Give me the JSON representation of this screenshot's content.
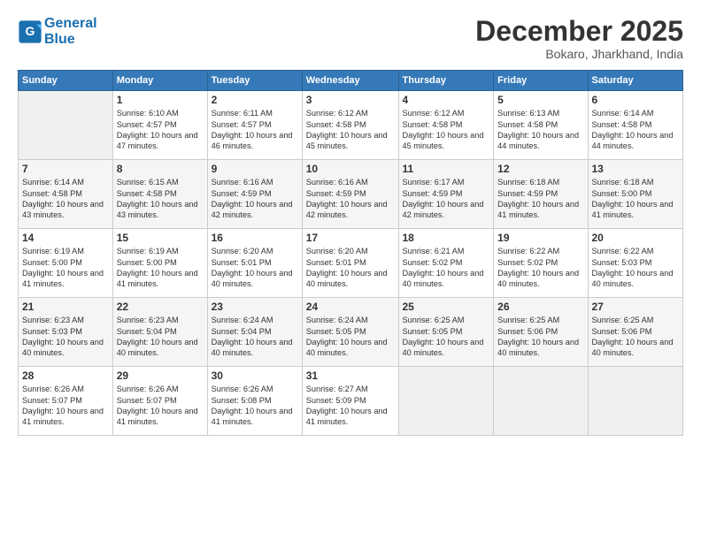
{
  "header": {
    "logo_line1": "General",
    "logo_line2": "Blue",
    "month": "December 2025",
    "location": "Bokaro, Jharkhand, India"
  },
  "days_of_week": [
    "Sunday",
    "Monday",
    "Tuesday",
    "Wednesday",
    "Thursday",
    "Friday",
    "Saturday"
  ],
  "weeks": [
    [
      {
        "day": "",
        "sunrise": "",
        "sunset": "",
        "daylight": ""
      },
      {
        "day": "1",
        "sunrise": "Sunrise: 6:10 AM",
        "sunset": "Sunset: 4:57 PM",
        "daylight": "Daylight: 10 hours and 47 minutes."
      },
      {
        "day": "2",
        "sunrise": "Sunrise: 6:11 AM",
        "sunset": "Sunset: 4:57 PM",
        "daylight": "Daylight: 10 hours and 46 minutes."
      },
      {
        "day": "3",
        "sunrise": "Sunrise: 6:12 AM",
        "sunset": "Sunset: 4:58 PM",
        "daylight": "Daylight: 10 hours and 45 minutes."
      },
      {
        "day": "4",
        "sunrise": "Sunrise: 6:12 AM",
        "sunset": "Sunset: 4:58 PM",
        "daylight": "Daylight: 10 hours and 45 minutes."
      },
      {
        "day": "5",
        "sunrise": "Sunrise: 6:13 AM",
        "sunset": "Sunset: 4:58 PM",
        "daylight": "Daylight: 10 hours and 44 minutes."
      },
      {
        "day": "6",
        "sunrise": "Sunrise: 6:14 AM",
        "sunset": "Sunset: 4:58 PM",
        "daylight": "Daylight: 10 hours and 44 minutes."
      }
    ],
    [
      {
        "day": "7",
        "sunrise": "Sunrise: 6:14 AM",
        "sunset": "Sunset: 4:58 PM",
        "daylight": "Daylight: 10 hours and 43 minutes."
      },
      {
        "day": "8",
        "sunrise": "Sunrise: 6:15 AM",
        "sunset": "Sunset: 4:58 PM",
        "daylight": "Daylight: 10 hours and 43 minutes."
      },
      {
        "day": "9",
        "sunrise": "Sunrise: 6:16 AM",
        "sunset": "Sunset: 4:59 PM",
        "daylight": "Daylight: 10 hours and 42 minutes."
      },
      {
        "day": "10",
        "sunrise": "Sunrise: 6:16 AM",
        "sunset": "Sunset: 4:59 PM",
        "daylight": "Daylight: 10 hours and 42 minutes."
      },
      {
        "day": "11",
        "sunrise": "Sunrise: 6:17 AM",
        "sunset": "Sunset: 4:59 PM",
        "daylight": "Daylight: 10 hours and 42 minutes."
      },
      {
        "day": "12",
        "sunrise": "Sunrise: 6:18 AM",
        "sunset": "Sunset: 4:59 PM",
        "daylight": "Daylight: 10 hours and 41 minutes."
      },
      {
        "day": "13",
        "sunrise": "Sunrise: 6:18 AM",
        "sunset": "Sunset: 5:00 PM",
        "daylight": "Daylight: 10 hours and 41 minutes."
      }
    ],
    [
      {
        "day": "14",
        "sunrise": "Sunrise: 6:19 AM",
        "sunset": "Sunset: 5:00 PM",
        "daylight": "Daylight: 10 hours and 41 minutes."
      },
      {
        "day": "15",
        "sunrise": "Sunrise: 6:19 AM",
        "sunset": "Sunset: 5:00 PM",
        "daylight": "Daylight: 10 hours and 41 minutes."
      },
      {
        "day": "16",
        "sunrise": "Sunrise: 6:20 AM",
        "sunset": "Sunset: 5:01 PM",
        "daylight": "Daylight: 10 hours and 40 minutes."
      },
      {
        "day": "17",
        "sunrise": "Sunrise: 6:20 AM",
        "sunset": "Sunset: 5:01 PM",
        "daylight": "Daylight: 10 hours and 40 minutes."
      },
      {
        "day": "18",
        "sunrise": "Sunrise: 6:21 AM",
        "sunset": "Sunset: 5:02 PM",
        "daylight": "Daylight: 10 hours and 40 minutes."
      },
      {
        "day": "19",
        "sunrise": "Sunrise: 6:22 AM",
        "sunset": "Sunset: 5:02 PM",
        "daylight": "Daylight: 10 hours and 40 minutes."
      },
      {
        "day": "20",
        "sunrise": "Sunrise: 6:22 AM",
        "sunset": "Sunset: 5:03 PM",
        "daylight": "Daylight: 10 hours and 40 minutes."
      }
    ],
    [
      {
        "day": "21",
        "sunrise": "Sunrise: 6:23 AM",
        "sunset": "Sunset: 5:03 PM",
        "daylight": "Daylight: 10 hours and 40 minutes."
      },
      {
        "day": "22",
        "sunrise": "Sunrise: 6:23 AM",
        "sunset": "Sunset: 5:04 PM",
        "daylight": "Daylight: 10 hours and 40 minutes."
      },
      {
        "day": "23",
        "sunrise": "Sunrise: 6:24 AM",
        "sunset": "Sunset: 5:04 PM",
        "daylight": "Daylight: 10 hours and 40 minutes."
      },
      {
        "day": "24",
        "sunrise": "Sunrise: 6:24 AM",
        "sunset": "Sunset: 5:05 PM",
        "daylight": "Daylight: 10 hours and 40 minutes."
      },
      {
        "day": "25",
        "sunrise": "Sunrise: 6:25 AM",
        "sunset": "Sunset: 5:05 PM",
        "daylight": "Daylight: 10 hours and 40 minutes."
      },
      {
        "day": "26",
        "sunrise": "Sunrise: 6:25 AM",
        "sunset": "Sunset: 5:06 PM",
        "daylight": "Daylight: 10 hours and 40 minutes."
      },
      {
        "day": "27",
        "sunrise": "Sunrise: 6:25 AM",
        "sunset": "Sunset: 5:06 PM",
        "daylight": "Daylight: 10 hours and 40 minutes."
      }
    ],
    [
      {
        "day": "28",
        "sunrise": "Sunrise: 6:26 AM",
        "sunset": "Sunset: 5:07 PM",
        "daylight": "Daylight: 10 hours and 41 minutes."
      },
      {
        "day": "29",
        "sunrise": "Sunrise: 6:26 AM",
        "sunset": "Sunset: 5:07 PM",
        "daylight": "Daylight: 10 hours and 41 minutes."
      },
      {
        "day": "30",
        "sunrise": "Sunrise: 6:26 AM",
        "sunset": "Sunset: 5:08 PM",
        "daylight": "Daylight: 10 hours and 41 minutes."
      },
      {
        "day": "31",
        "sunrise": "Sunrise: 6:27 AM",
        "sunset": "Sunset: 5:09 PM",
        "daylight": "Daylight: 10 hours and 41 minutes."
      },
      {
        "day": "",
        "sunrise": "",
        "sunset": "",
        "daylight": ""
      },
      {
        "day": "",
        "sunrise": "",
        "sunset": "",
        "daylight": ""
      },
      {
        "day": "",
        "sunrise": "",
        "sunset": "",
        "daylight": ""
      }
    ]
  ]
}
